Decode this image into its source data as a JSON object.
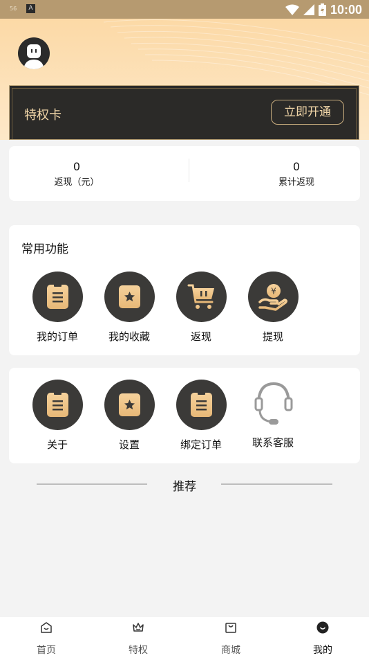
{
  "status_bar": {
    "signal_text": "56",
    "launcher_glyph": "A",
    "time": "10:00"
  },
  "privilege_card": {
    "title": "特权卡",
    "open_button": "立即开通"
  },
  "stats": [
    {
      "value": "0",
      "label": "返现（元）"
    },
    {
      "value": "0",
      "label": "累计返现"
    }
  ],
  "common_functions": {
    "title": "常用功能",
    "items": [
      {
        "label": "我的订单",
        "icon": "clipboard-icon"
      },
      {
        "label": "我的收藏",
        "icon": "star-icon"
      },
      {
        "label": "返现",
        "icon": "cart-icon"
      },
      {
        "label": "提现",
        "icon": "yen-hand-icon"
      }
    ]
  },
  "more_functions": {
    "items": [
      {
        "label": "关于",
        "icon": "clipboard-icon"
      },
      {
        "label": "设置",
        "icon": "star-icon"
      },
      {
        "label": "绑定订单",
        "icon": "clipboard-icon"
      },
      {
        "label": "联系客服",
        "icon": "headset-icon"
      }
    ]
  },
  "recommend": {
    "label": "推荐"
  },
  "tabbar": {
    "items": [
      {
        "label": "首页",
        "icon": "home-icon",
        "active": false
      },
      {
        "label": "特权",
        "icon": "crown-icon",
        "active": false
      },
      {
        "label": "商城",
        "icon": "bag-icon",
        "active": false
      },
      {
        "label": "我的",
        "icon": "profile-icon",
        "active": true
      }
    ]
  },
  "colors": {
    "accent_gold": "#f1d6a8",
    "dark_circle": "#3b3a38",
    "header_top": "#fcd9a6",
    "status_bar": "#b69a70"
  }
}
